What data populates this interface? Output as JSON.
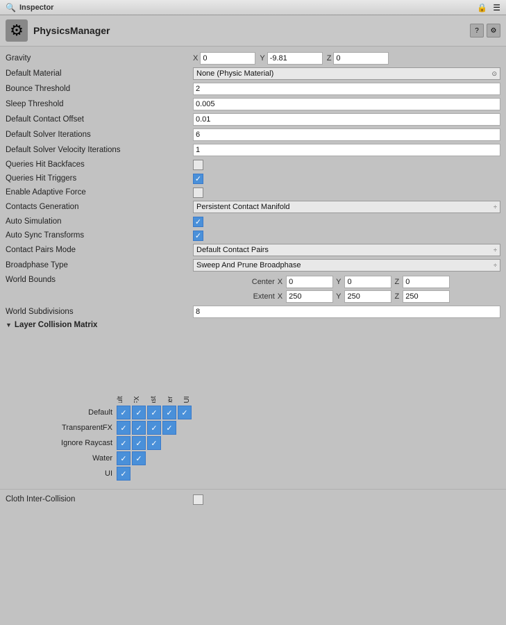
{
  "titleBar": {
    "title": "Inspector",
    "lockIcon": "🔒",
    "menuIcon": "☰"
  },
  "header": {
    "icon": "⚙",
    "title": "PhysicsManager",
    "helpBtn": "?",
    "settingsBtn": "⚙"
  },
  "fields": {
    "gravity": {
      "label": "Gravity",
      "x": "0",
      "y": "-9.81",
      "z": "0"
    },
    "defaultMaterial": {
      "label": "Default Material",
      "value": "None (Physic Material)"
    },
    "bounceThreshold": {
      "label": "Bounce Threshold",
      "value": "2"
    },
    "sleepThreshold": {
      "label": "Sleep Threshold",
      "value": "0.005"
    },
    "defaultContactOffset": {
      "label": "Default Contact Offset",
      "value": "0.01"
    },
    "defaultSolverIterations": {
      "label": "Default Solver Iterations",
      "value": "6"
    },
    "defaultSolverVelocityIterations": {
      "label": "Default Solver Velocity Iterations",
      "value": "1"
    },
    "queriesHitBackfaces": {
      "label": "Queries Hit Backfaces",
      "checked": false
    },
    "queriesHitTriggers": {
      "label": "Queries Hit Triggers",
      "checked": true
    },
    "enableAdaptiveForce": {
      "label": "Enable Adaptive Force",
      "checked": false
    },
    "contactsGeneration": {
      "label": "Contacts Generation",
      "value": "Persistent Contact Manifold"
    },
    "autoSimulation": {
      "label": "Auto Simulation",
      "checked": true
    },
    "autoSyncTransforms": {
      "label": "Auto Sync Transforms",
      "checked": true
    },
    "contactPairsMode": {
      "label": "Contact Pairs Mode",
      "value": "Default Contact Pairs"
    },
    "broadphaseType": {
      "label": "Broadphase Type",
      "value": "Sweep And Prune Broadphase"
    }
  },
  "worldBounds": {
    "label": "World Bounds",
    "center": {
      "label": "Center",
      "x": "0",
      "y": "0",
      "z": "0"
    },
    "extent": {
      "label": "Extent",
      "x": "250",
      "y": "250",
      "z": "250"
    }
  },
  "worldSubdivisions": {
    "label": "World Subdivisions",
    "value": "8"
  },
  "layerCollisionMatrix": {
    "label": "Layer Collision Matrix",
    "colLabels": [
      "Default",
      "TransparentFX",
      "Ignore Raycast",
      "Water",
      "UI"
    ],
    "rows": [
      {
        "label": "Default",
        "cells": [
          true,
          true,
          true,
          true,
          true
        ]
      },
      {
        "label": "TransparentFX",
        "cells": [
          true,
          true,
          true,
          true
        ]
      },
      {
        "label": "Ignore Raycast",
        "cells": [
          true,
          true,
          true
        ]
      },
      {
        "label": "Water",
        "cells": [
          true,
          true
        ]
      },
      {
        "label": "UI",
        "cells": [
          true
        ]
      }
    ]
  },
  "clothInterCollision": {
    "label": "Cloth Inter-Collision",
    "checked": false
  },
  "checkmark": "✓"
}
